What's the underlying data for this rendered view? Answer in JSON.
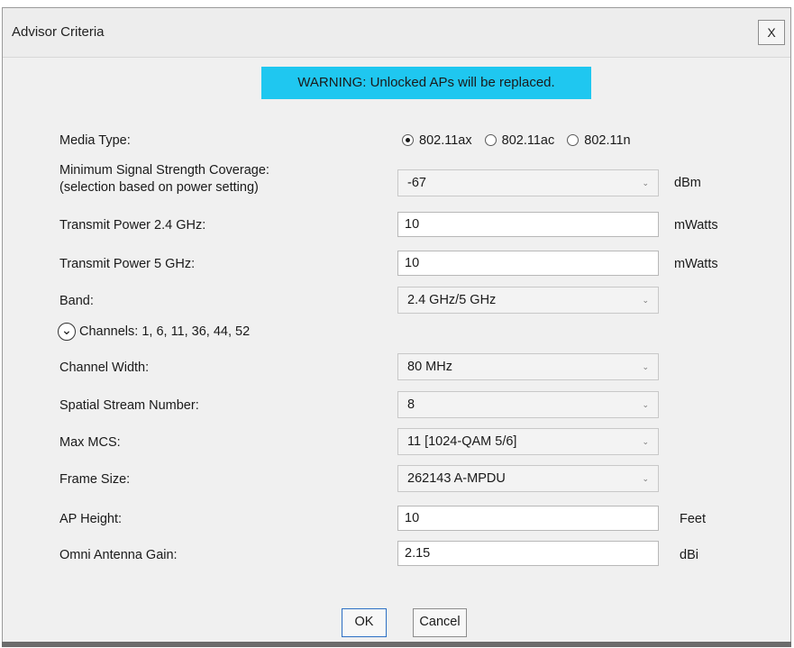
{
  "window": {
    "title": "Advisor Criteria",
    "close_label": "X"
  },
  "warning": "WARNING: Unlocked APs will be replaced.",
  "media_type": {
    "label": "Media Type:",
    "options": [
      "802.11ax",
      "802.11ac",
      "802.11n"
    ],
    "selected": "802.11ax"
  },
  "min_signal": {
    "label_line1": "Minimum Signal Strength Coverage:",
    "label_line2": "(selection based on power setting)",
    "value": "-67",
    "unit": "dBm"
  },
  "tx_power_24": {
    "label": "Transmit Power 2.4 GHz:",
    "value": "10",
    "unit": "mWatts"
  },
  "tx_power_5": {
    "label": "Transmit Power 5 GHz:",
    "value": "10",
    "unit": "mWatts"
  },
  "band": {
    "label": "Band:",
    "value": "2.4 GHz/5 GHz"
  },
  "channels": {
    "label": "Channels: 1, 6, 11, 36, 44, 52"
  },
  "channel_width": {
    "label": "Channel Width:",
    "value": "80 MHz"
  },
  "spatial_stream": {
    "label": "Spatial Stream Number:",
    "value": "8"
  },
  "max_mcs": {
    "label": "Max MCS:",
    "value": "11 [1024-QAM 5/6]"
  },
  "frame_size": {
    "label": "Frame Size:",
    "value": "262143 A-MPDU"
  },
  "ap_height": {
    "label": "AP Height:",
    "value": "10",
    "unit": "Feet"
  },
  "antenna_gain": {
    "label": "Omni Antenna Gain:",
    "value": "2.15",
    "unit": "dBi"
  },
  "buttons": {
    "ok": "OK",
    "cancel": "Cancel"
  },
  "colors": {
    "warning_bg": "#1fc7f0",
    "ok_border": "#2c6fc4"
  },
  "icons": {
    "dropdown": "chevron-down-icon",
    "expander": "chevron-down-circle-icon"
  }
}
